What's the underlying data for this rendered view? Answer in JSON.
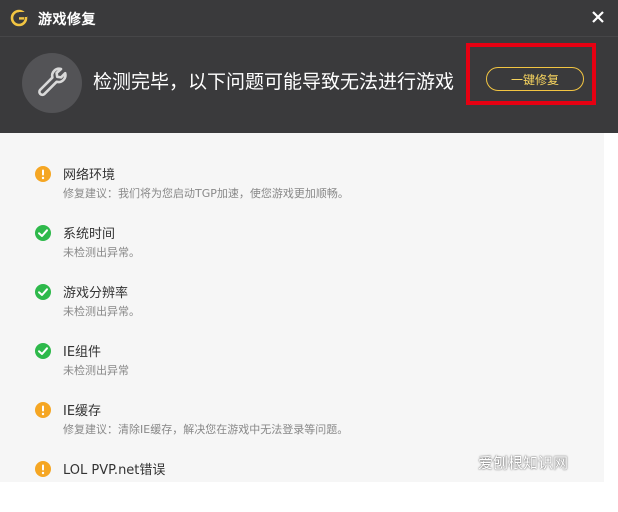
{
  "window": {
    "title": "游戏修复",
    "close_symbol": "✕"
  },
  "header": {
    "message": "检测完毕，以下问题可能导致无法进行游戏",
    "fix_button_label": "一键修复",
    "icon": "wrench-icon"
  },
  "colors": {
    "bg_dark": "#3a3a3c",
    "accent_gold": "#f2c542",
    "warning": "#f5a623",
    "ok": "#2eb94b",
    "highlight_red": "#e60012"
  },
  "items": [
    {
      "status": "warning",
      "title": "网络环境",
      "desc": "修复建议：我们将为您启动TGP加速，使您游戏更加顺畅。"
    },
    {
      "status": "ok",
      "title": "系统时间",
      "desc": "未检测出异常。"
    },
    {
      "status": "ok",
      "title": "游戏分辨率",
      "desc": "未检测出异常。"
    },
    {
      "status": "ok",
      "title": "IE组件",
      "desc": "未检测出异常"
    },
    {
      "status": "warning",
      "title": "IE缓存",
      "desc": "修复建议：清除IE缓存，解决您在游戏中无法登录等问题。"
    },
    {
      "status": "warning",
      "title": "LOL PVP.net错误",
      "desc": ""
    }
  ],
  "watermark": "爱刨根知识网"
}
